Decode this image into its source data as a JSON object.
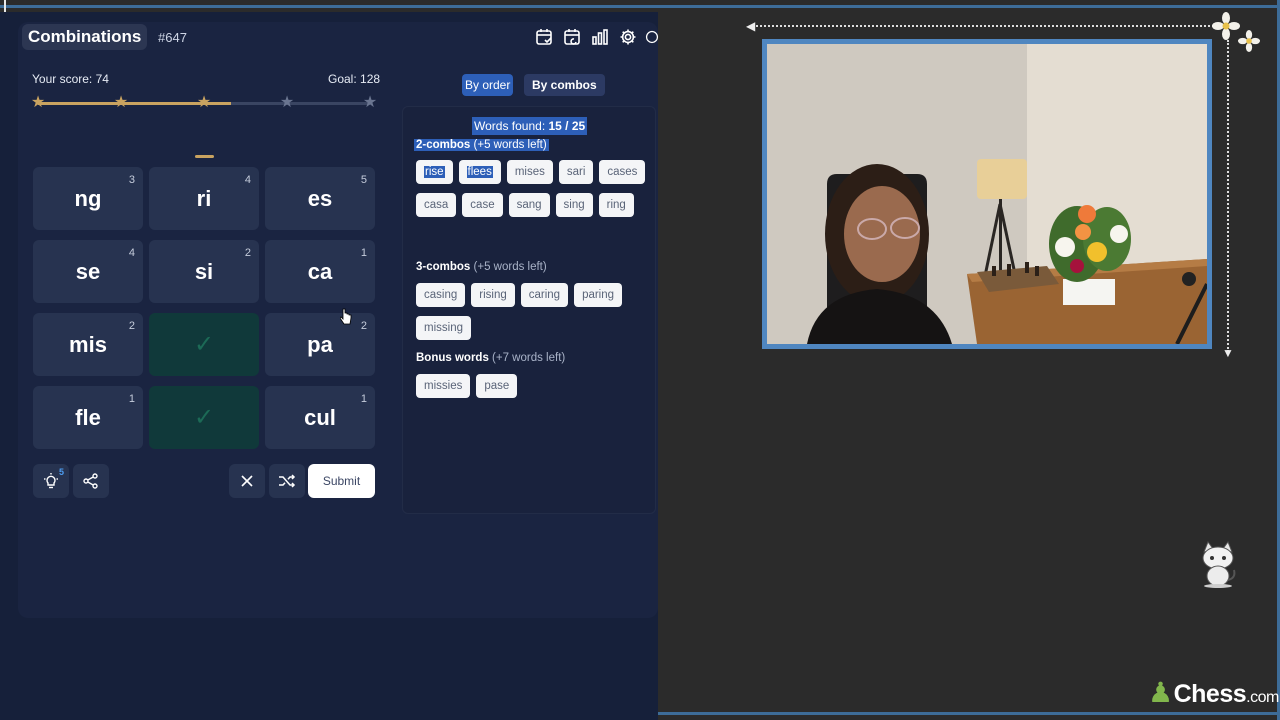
{
  "game": {
    "title": "Combinations",
    "puzzle_number": "#647",
    "score_label": "Your score: 74",
    "goal_label": "Goal: 128",
    "score_progress": 0.58,
    "stars_earned": 3,
    "stars_total": 5,
    "hint_badge": "5",
    "submit_label": "Submit",
    "tiles": [
      {
        "text": "ng",
        "count": "3"
      },
      {
        "text": "ri",
        "count": "4"
      },
      {
        "text": "es",
        "count": "5"
      },
      {
        "text": "se",
        "count": "4"
      },
      {
        "text": "si",
        "count": "2"
      },
      {
        "text": "ca",
        "count": "1"
      },
      {
        "text": "mis",
        "count": "2"
      },
      {
        "text": "",
        "count": "",
        "done": true
      },
      {
        "text": "pa",
        "count": "2"
      },
      {
        "text": "fle",
        "count": "1"
      },
      {
        "text": "",
        "count": "",
        "done": true
      },
      {
        "text": "cul",
        "count": "1"
      }
    ],
    "icons": [
      "calendar-check-icon",
      "calendar-refresh-icon",
      "stats-icon",
      "gear-icon",
      "help-icon"
    ]
  },
  "words": {
    "tab_order": "By order",
    "tab_combos": "By combos",
    "found_prefix": "Words found: ",
    "found_value": "15 / 25",
    "sections": [
      {
        "title": "2-combos",
        "left": "(+5 words left)",
        "words": [
          "rise",
          "flees",
          "mises",
          "sari",
          "cases",
          "casa",
          "case",
          "sang",
          "sing",
          "ring"
        ]
      },
      {
        "title": "3-combos",
        "left": "(+5 words left)",
        "words": [
          "casing",
          "rising",
          "caring",
          "paring",
          "missing"
        ]
      },
      {
        "title": "Bonus words",
        "left": "(+7 words left)",
        "words": [
          "missies",
          "pase"
        ]
      }
    ]
  },
  "brand": {
    "name": "Chess",
    "suffix": ".com"
  },
  "colors": {
    "accent": "#2d5fb8",
    "gold": "#c9a360",
    "panel": "#16203a",
    "frame": "#4f86c0",
    "chess_green": "#81b64c"
  }
}
